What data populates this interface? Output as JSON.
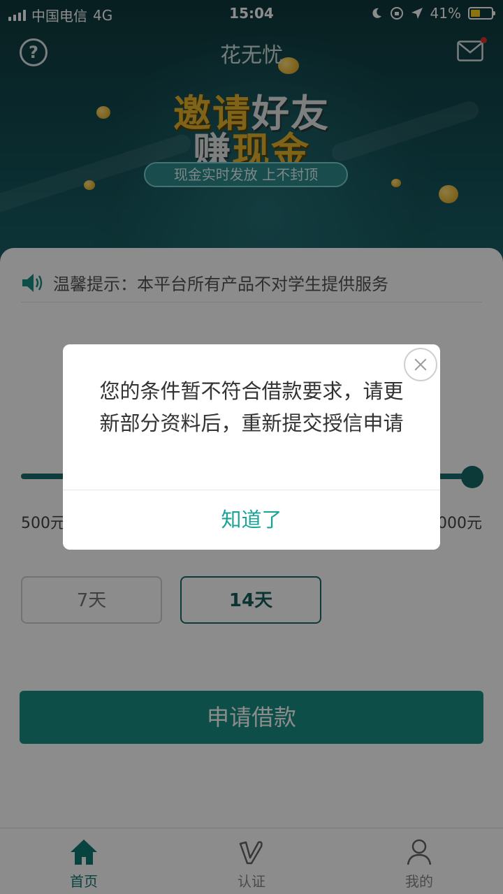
{
  "status_bar": {
    "carrier": "中国电信",
    "network": "4G",
    "time": "15:04",
    "battery": "41%"
  },
  "header": {
    "title": "花无忧",
    "help_icon": "question-circle-icon",
    "mail_icon": "envelope-icon",
    "banner": {
      "line1_part1": "邀请",
      "line1_part2": "好友",
      "line2_part1": "赚",
      "line2_part2": "现金",
      "tagline": "现金实时发放  上不封顶"
    }
  },
  "notice": {
    "icon": "speaker-icon",
    "text": "温馨提示：本平台所有产品不对学生提供服务"
  },
  "loan": {
    "amount_min": "500元",
    "amount_max": "000元",
    "slider_level": 1.0,
    "terms": [
      {
        "label": "7天",
        "selected": false
      },
      {
        "label": "14天",
        "selected": true
      }
    ],
    "apply_label": "申请借款"
  },
  "tabbar": {
    "items": [
      {
        "label": "首页",
        "icon": "home-icon",
        "active": true
      },
      {
        "label": "认证",
        "icon": "verify-icon",
        "active": false
      },
      {
        "label": "我的",
        "icon": "user-icon",
        "active": false
      }
    ]
  },
  "dialog": {
    "message": "您的条件暂不符合借款要求，请更新部分资料后，重新提交授信申请",
    "confirm_label": "知道了"
  },
  "colors": {
    "accent": "#1aa396",
    "primary_dark": "#145e5a",
    "header_bg": "#135158",
    "gold": "#e8b52c",
    "mail_dot": "#e0302b"
  }
}
